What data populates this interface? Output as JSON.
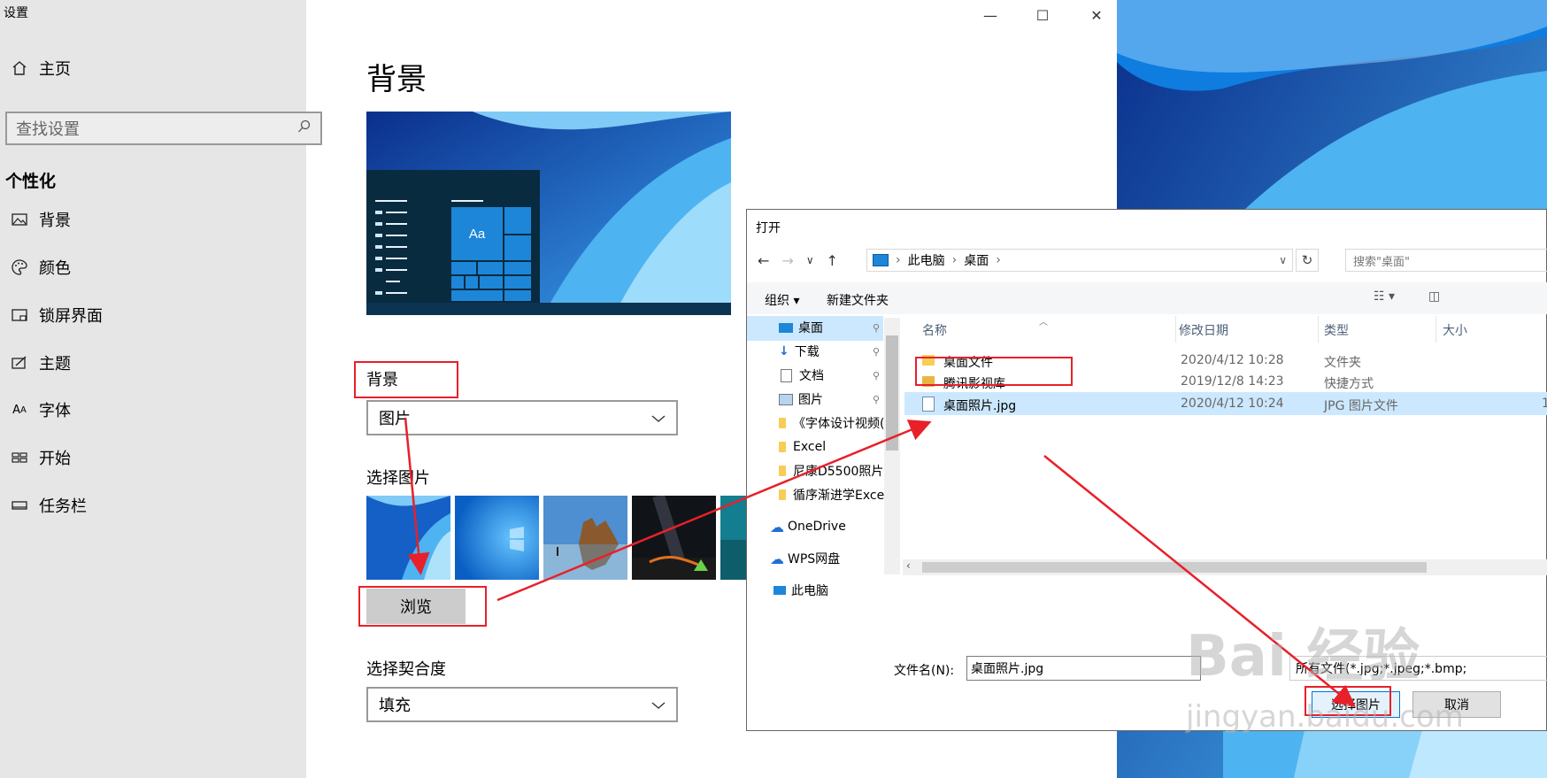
{
  "app": {
    "title": "设置"
  },
  "nav": {
    "home": "主页",
    "search_placeholder": "查找设置",
    "section": "个性化",
    "items": [
      {
        "label": "背景",
        "icon": "image-icon"
      },
      {
        "label": "颜色",
        "icon": "palette-icon"
      },
      {
        "label": "锁屏界面",
        "icon": "lock-screen-icon"
      },
      {
        "label": "主题",
        "icon": "theme-icon"
      },
      {
        "label": "字体",
        "icon": "font-icon"
      },
      {
        "label": "开始",
        "icon": "start-icon"
      },
      {
        "label": "任务栏",
        "icon": "taskbar-icon"
      }
    ]
  },
  "window": {
    "minimize": "—",
    "maximize": "☐",
    "close": "✕"
  },
  "main": {
    "title": "背景",
    "preview_tile_text": "Aa",
    "background_label": "背景",
    "background_value": "图片",
    "choose_picture_label": "选择图片",
    "browse_label": "浏览",
    "fit_label": "选择契合度",
    "fit_value": "填充"
  },
  "dialog": {
    "title": "打开",
    "breadcrumb": [
      "此电脑",
      "桌面"
    ],
    "search_placeholder": "搜索\"桌面\"",
    "toolbar": {
      "organize": "组织 ▾",
      "new_folder": "新建文件夹"
    },
    "tree": [
      {
        "label": "桌面",
        "type": "desktop",
        "pinned": true,
        "selected": true
      },
      {
        "label": "下载",
        "type": "download",
        "pinned": true
      },
      {
        "label": "文档",
        "type": "document",
        "pinned": true
      },
      {
        "label": "图片",
        "type": "pictures",
        "pinned": true
      },
      {
        "label": "《字体设计视频(",
        "type": "folder"
      },
      {
        "label": "Excel",
        "type": "folder"
      },
      {
        "label": "尼康D5500照片",
        "type": "folder"
      },
      {
        "label": "循序渐进学Exce",
        "type": "folder"
      },
      {
        "label": "OneDrive",
        "type": "onedrive"
      },
      {
        "label": "WPS网盘",
        "type": "cloud"
      },
      {
        "label": "此电脑",
        "type": "pc"
      }
    ],
    "columns": {
      "name": "名称",
      "modified": "修改日期",
      "type": "类型",
      "size": "大小"
    },
    "files": [
      {
        "name": "桌面文件",
        "modified": "2020/4/12 10:28",
        "type": "文件夹",
        "size": ""
      },
      {
        "name": "腾讯影视库",
        "modified": "2019/12/8 14:23",
        "type": "快捷方式",
        "size": ""
      },
      {
        "name": "桌面照片.jpg",
        "modified": "2020/4/12 10:24",
        "type": "JPG 图片文件",
        "size": "1",
        "selected": true
      }
    ],
    "filename_label": "文件名(N):",
    "filename_value": "桌面照片.jpg",
    "filter_value": "所有文件(*.jpg;*.jpeg;*.bmp;",
    "open_label": "选择图片",
    "cancel_label": "取消"
  },
  "watermark": {
    "line1": "Bai 经验",
    "line2": "jingyan.baidu.com"
  },
  "colors": {
    "annotation_red": "#e8202a",
    "accent_blue": "#0078d7",
    "nav_bg": "#e6e6e6"
  }
}
